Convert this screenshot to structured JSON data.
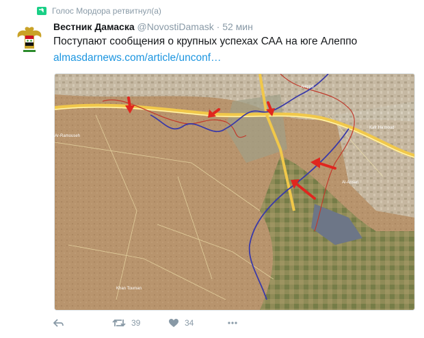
{
  "retweet": {
    "text": "Голос Мордора ретвитнул(а)",
    "icon": "retweet-icon"
  },
  "author": {
    "name": "Вестник Дамаска",
    "handle": "@NovostiDamask",
    "separator": "·",
    "time": "52 мин",
    "avatar_icon": "syrian-eagle-avatar"
  },
  "tweet": {
    "text": "Поступают сообщения о крупных успехах САА на юге Алеппо",
    "link": "almasdarnews.com/article/unconf…"
  },
  "map_labels": [
    "Ar-Ramouseh",
    "Aleppo",
    "Kafr Ha'moud",
    "Al-Ansari",
    "Khan Touman"
  ],
  "actions": {
    "reply_icon": "reply-icon",
    "retweet_icon": "retweet-icon",
    "retweet_count": "39",
    "like_icon": "heart-icon",
    "like_count": "34",
    "more_icon": "more-icon"
  },
  "colors": {
    "accent": "#1b95e0",
    "muted": "#8899a6",
    "retweet_green": "#19cf86",
    "arrow_red": "#e0261f"
  }
}
